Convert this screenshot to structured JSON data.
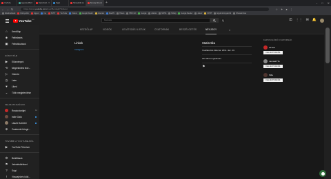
{
  "browser": {
    "tabs": [
      {
        "title": "YouTube",
        "favicon": "red"
      },
      {
        "title": "Agenda (85) Illettes a matem",
        "favicon": "green"
      },
      {
        "title": "David Feld - YouTube",
        "favicon": "red"
      },
      {
        "title": "Tagét",
        "favicon": "blue"
      },
      {
        "title": "Hatosáhilik momlan - YouTube",
        "favicon": "red"
      },
      {
        "title": "Bemlajd (Nemlait) - Tagét",
        "favicon": "red",
        "active": true
      }
    ],
    "new_tab": "+",
    "window_controls": [
      "–",
      "□",
      "✕"
    ],
    "url_host": "youtube.com",
    "url_path": "/user/Bemlajd76/about",
    "url_prefix": "https://www.",
    "bookmarks": [
      {
        "label": "Alkalmazások",
        "color": "#777777"
      },
      {
        "label": "Könnyezők",
        "color": "#e33333"
      },
      {
        "label": "Ingyen",
        "color": "#e33333"
      },
      {
        "label": "Inq",
        "color": "#3a7bd5"
      },
      {
        "label": "ShHY",
        "color": "#e33333"
      },
      {
        "label": "YouTube",
        "color": "#e33333"
      },
      {
        "label": "Videos",
        "color": "#3a7bd5"
      },
      {
        "label": "Google Weath",
        "color": "#4caf50"
      },
      {
        "label": "Jelentés",
        "color": "#dbb23a"
      },
      {
        "label": "MacPC",
        "color": "#3a7bd5"
      },
      {
        "label": "Hotels",
        "color": "#777777"
      },
      {
        "label": "HBO GO",
        "color": "#777777"
      },
      {
        "label": "Google",
        "color": "#4caf50"
      },
      {
        "label": "Aláírás",
        "color": "#777777"
      },
      {
        "label": "NRHA",
        "color": "#777777"
      },
      {
        "label": "Hidlap",
        "color": "#777777"
      },
      {
        "label": "Google Reader",
        "color": "#4caf50"
      },
      {
        "label": "Jelesz",
        "color": "#777777"
      },
      {
        "label": "KPMT",
        "color": "#dbb23a"
      },
      {
        "label": "Egyéb könyvjelzők",
        "color": "#777777"
      },
      {
        "label": "Olvasási lista",
        "color": "#777777"
      }
    ]
  },
  "youtube": {
    "logo_text": "YouTube",
    "logo_country": "HU",
    "search_placeholder": "Keresés",
    "header_icons": [
      "camera-icon",
      "apps-icon",
      "chat-icon",
      "bell-icon"
    ]
  },
  "sidebar": {
    "main_items": [
      {
        "icon": "⌂",
        "label": "Kezdőlap",
        "name": "sidebar-item-home"
      },
      {
        "icon": "◈",
        "label": "Felfedezés",
        "name": "sidebar-item-explore"
      },
      {
        "icon": "▣",
        "label": "Feliratkozások",
        "name": "sidebar-item-subscriptions"
      }
    ],
    "library_head": "Könyvtár",
    "library_items": [
      {
        "icon": "▶",
        "label": "Előzmények",
        "name": "sidebar-item-history"
      },
      {
        "icon": "⟲",
        "label": "Megtekintési előz...",
        "name": "sidebar-item-watch-history"
      },
      {
        "icon": "▷",
        "label": "Videóim",
        "name": "sidebar-item-your-videos"
      },
      {
        "icon": "◷",
        "label": "Later",
        "name": "sidebar-item-watch-later"
      },
      {
        "icon": "♥",
        "label": "Liked",
        "name": "sidebar-item-liked"
      },
      {
        "icon": "⌄",
        "label": "Több megjelenítése",
        "name": "sidebar-item-show-more"
      }
    ],
    "subs_head": "Feliratkozások",
    "subs_items": [
      {
        "label": "Russia tonight",
        "color": "#c62828",
        "count": "12",
        "name": "sidebar-channel-1"
      },
      {
        "label": "Indie Gala",
        "color": "#6d4c41",
        "dot": true,
        "name": "sidebar-channel-2"
      },
      {
        "label": "László Szemler",
        "color": "#8d7b68",
        "dot": true,
        "name": "sidebar-channel-3"
      },
      {
        "label": "Csatornák böngé...",
        "icon": "⊕",
        "name": "sidebar-browse-channels"
      }
    ],
    "more_head": "További a YouTube-ból",
    "more_items": [
      {
        "icon": "▶",
        "label": "YouTube Prémium",
        "name": "sidebar-item-premium"
      }
    ],
    "settings_items": [
      {
        "icon": "⚙",
        "label": "Beállítások",
        "name": "sidebar-item-settings"
      },
      {
        "icon": "⚑",
        "label": "Jelentéstörténet",
        "name": "sidebar-item-report-history"
      },
      {
        "icon": "?",
        "label": "Súgó",
        "name": "sidebar-item-help"
      },
      {
        "icon": "!",
        "label": "Visszajelzés küld...",
        "name": "sidebar-item-feedback"
      }
    ]
  },
  "channel_tabs": [
    {
      "label": "KEZDŐLAP",
      "name": "tab-home"
    },
    {
      "label": "VIDEÓK",
      "name": "tab-videos"
    },
    {
      "label": "LEJÁTSZÁSI LISTÁK",
      "name": "tab-playlists"
    },
    {
      "label": "CSATORNÁK",
      "name": "tab-channels"
    },
    {
      "label": "BESZÉLGETÉS",
      "name": "tab-discussion"
    },
    {
      "label": "NÉVJEGY",
      "name": "tab-about",
      "active": true
    }
  ],
  "about": {
    "links_title": "Linkek",
    "links": [
      "Instagram"
    ],
    "stats_title": "Statisztika",
    "joined": "Csatlakozás dátuma: 2011. dec. 20.",
    "views": "202 304 megtekintés",
    "flag_label": "⚑"
  },
  "featured": {
    "title": "KAPCSOLÓDÓ CSATORNÁK",
    "subscribe_label": "FELIRATKOZÁS",
    "channels": [
      {
        "name": "ATVolt",
        "color": "#c62828"
      },
      {
        "name": "namsakYTe",
        "color": "#888888"
      },
      {
        "name": "Sifia",
        "color": "#4e342e"
      }
    ]
  }
}
